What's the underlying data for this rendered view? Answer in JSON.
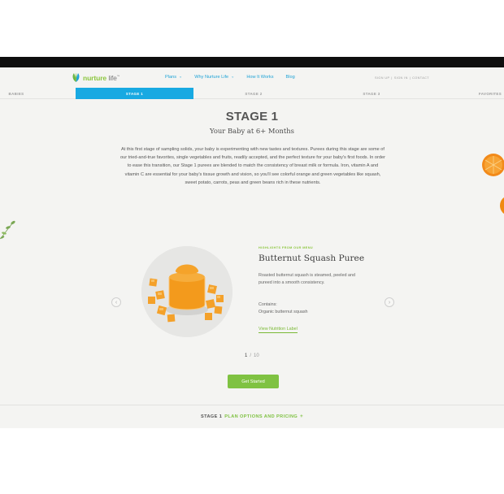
{
  "header": {
    "logo_text_brand": "nurture",
    "logo_text_rest": " life",
    "logo_tm": "™",
    "nav": [
      {
        "label": "Plans",
        "has_chevron": true
      },
      {
        "label": "Why Nurture Life",
        "has_chevron": true
      },
      {
        "label": "How It Works",
        "has_chevron": false
      },
      {
        "label": "Blog",
        "has_chevron": false
      }
    ],
    "util": [
      "SIGN UP",
      "|",
      "SIGN IN",
      "|",
      "CONTACT"
    ]
  },
  "tabs": [
    "BABIES",
    "STAGE 1",
    "STAGE 2",
    "STAGE 3",
    "FAVORITES"
  ],
  "stage": {
    "title": "STAGE 1",
    "subtitle": "Your Baby at 6+ Months",
    "description": "At this first stage of sampling solids, your baby is experimenting with new tastes and textures. Purees during this stage are some of our tried-and-true favorites, single vegetables and fruits, readily accepted, and the perfect texture for your baby's first foods. In order to ease this transition, our Stage 1 purees are blended to match the consistency of breast milk or formula. Iron, vitamin A and vitamin C are essential for your baby's tissue growth and vision, so you'll see colorful orange and green vegetables like squash, sweet potato, carrots, peas and green beans rich in these nutrients."
  },
  "product": {
    "highlight_label": "HIGHLIGHTS FROM OUR MENU",
    "name": "Butternut Squash Puree",
    "description": "Roasted butternut squash is steamed, peeled and pureed into a smooth consistency.",
    "contains_label": "Contains:",
    "contains_value": "Organic butternut squash",
    "nutrition_link": "View Nutrition Label"
  },
  "pager": {
    "current": "1",
    "separator": "/",
    "total": "10"
  },
  "cta": {
    "label": "Get Started"
  },
  "footer": {
    "stage": "STAGE 1",
    "link": "PLAN OPTIONS AND PRICING",
    "arrow": "+"
  },
  "icons": {
    "logo": "leaf-logo-icon",
    "prev": "chevron-left-icon",
    "next": "chevron-right-icon",
    "nav_dropdown": "chevron-down-icon"
  },
  "colors": {
    "brand_green": "#8cc63f",
    "nav_blue": "#1fa3d6",
    "active_tab": "#18a9e2",
    "cta_green": "#7fc242",
    "background": "#f4f4f2",
    "squash_orange": "#f39a1c"
  }
}
